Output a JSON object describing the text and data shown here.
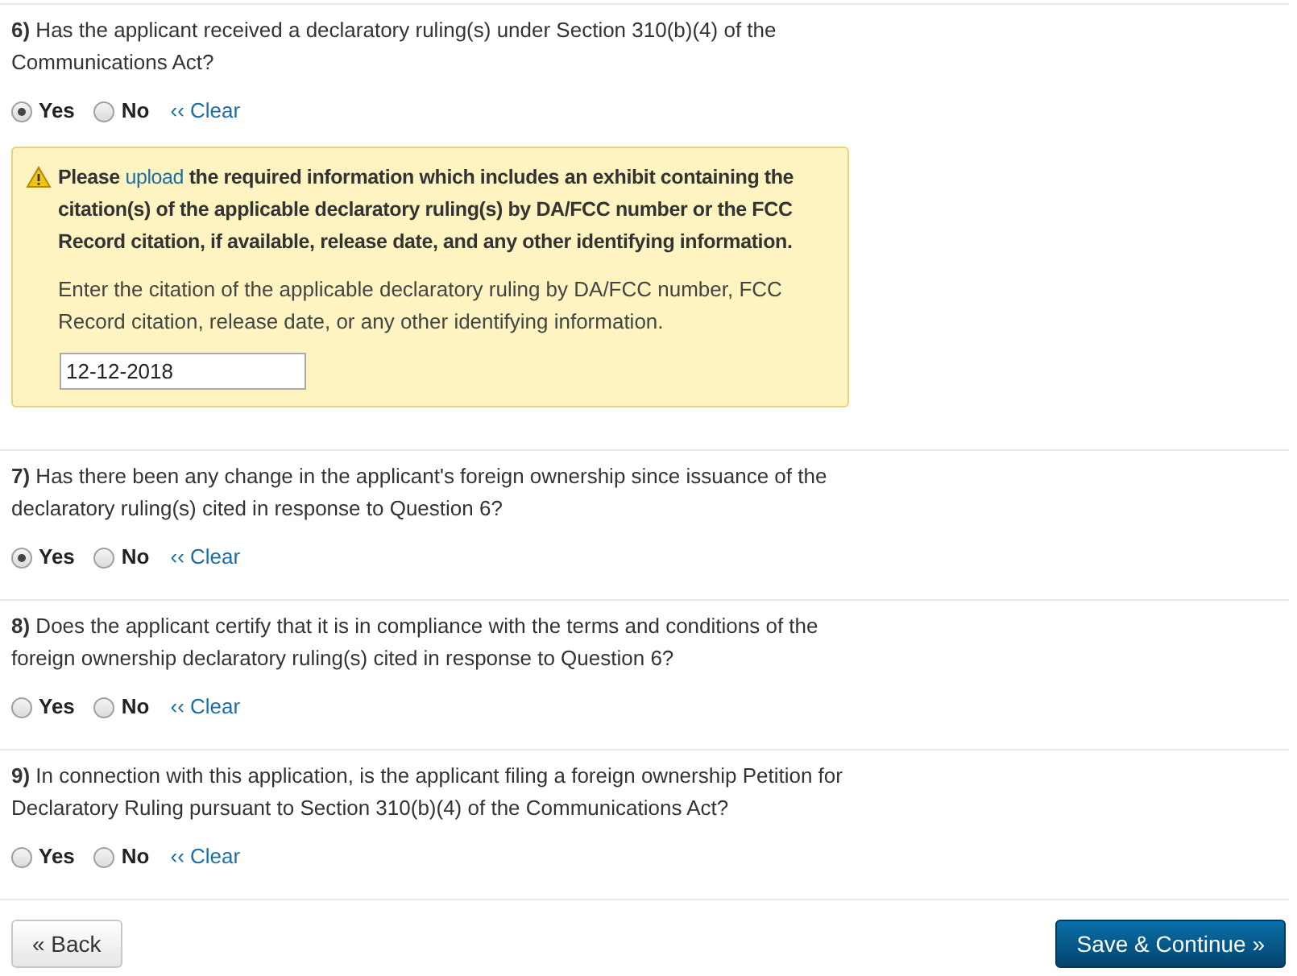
{
  "questions": [
    {
      "text": "**6)** Has the applicant received a declaratory ruling(s) under Section 310(b)(4) of the Communications Act?",
      "options": [
        {
          "label": "Yes",
          "selected": true
        },
        {
          "label": "No",
          "selected": false
        }
      ],
      "clear": "‹‹ Clear",
      "alert": {
        "before": "Please",
        "link": "upload",
        "after": "the required information which includes an exhibit containing the citation(s) of the applicable declaratory ruling(s) by DA/FCC number or the FCC Record citation, if available, release date, and any other identifying information.",
        "instruction": "Enter the citation of the applicable declaratory ruling by DA/FCC number, FCC Record citation, release date, or any other identifying information.",
        "value": "12-12-2018"
      }
    },
    {
      "text": "**7)** Has there been any change in the applicant's foreign ownership since issuance of the declaratory ruling(s) cited in response to Question 6?",
      "options": [
        {
          "label": "Yes",
          "selected": true
        },
        {
          "label": "No",
          "selected": false
        }
      ],
      "clear": "‹‹ Clear"
    },
    {
      "text": "**8)** Does the applicant certify that it is in compliance with the terms and conditions of the foreign ownership declaratory ruling(s) cited in response to Question 6?",
      "options": [
        {
          "label": "Yes",
          "selected": false
        },
        {
          "label": "No",
          "selected": false
        }
      ],
      "clear": "‹‹ Clear"
    },
    {
      "text": "**9)** In connection with this application, is the applicant filing a foreign ownership Petition for Declaratory Ruling pursuant to Section 310(b)(4) of the Communications Act?",
      "options": [
        {
          "label": "Yes",
          "selected": false
        },
        {
          "label": "No",
          "selected": false
        }
      ],
      "clear": "‹‹ Clear"
    }
  ],
  "buttons": {
    "back": "« Back",
    "save": "Save & Continue »"
  }
}
